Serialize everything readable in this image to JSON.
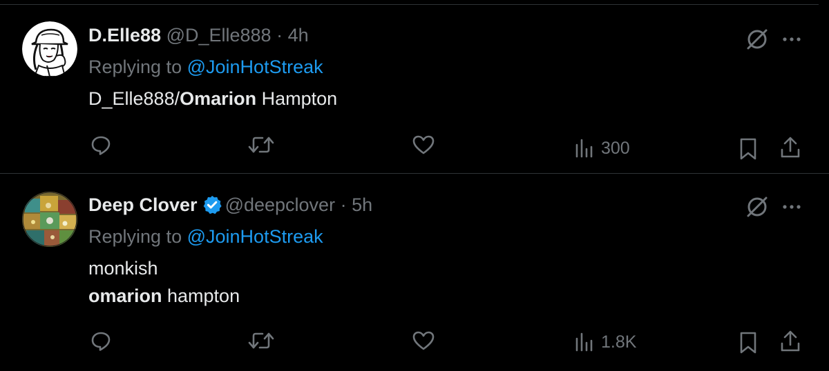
{
  "tweets": [
    {
      "display_name": "D.Elle88",
      "handle": "@D_Elle888",
      "separator": "·",
      "time": "4h",
      "replying_prefix": "Replying to",
      "replying_to": "@JoinHotStreak",
      "body": {
        "line1_a": "D_Elle888/",
        "line1_b": "Omarion",
        "line1_c": " Hampton"
      },
      "views": "300",
      "verified": false,
      "avatar_icon": "cartoon-woman-bucket-hat-avatar"
    },
    {
      "display_name": "Deep Clover",
      "handle": "@deepclover",
      "separator": "·",
      "time": "5h",
      "replying_prefix": "Replying to",
      "replying_to": "@JoinHotStreak",
      "body": {
        "line1": "monkish",
        "line2_a": "omarion",
        "line2_b": " hampton"
      },
      "views": "1.8K",
      "verified": true,
      "avatar_icon": "colorful-abstract-avatar"
    }
  ],
  "colors": {
    "background": "#000000",
    "primary_text": "#e7e9ea",
    "secondary_text": "#71767b",
    "accent": "#1d9bf0",
    "divider": "#2f3336"
  },
  "icons": [
    "grok-icon",
    "more-icon",
    "reply-icon",
    "retweet-icon",
    "like-icon",
    "views-icon",
    "bookmark-icon",
    "share-icon",
    "verified-badge-icon"
  ]
}
